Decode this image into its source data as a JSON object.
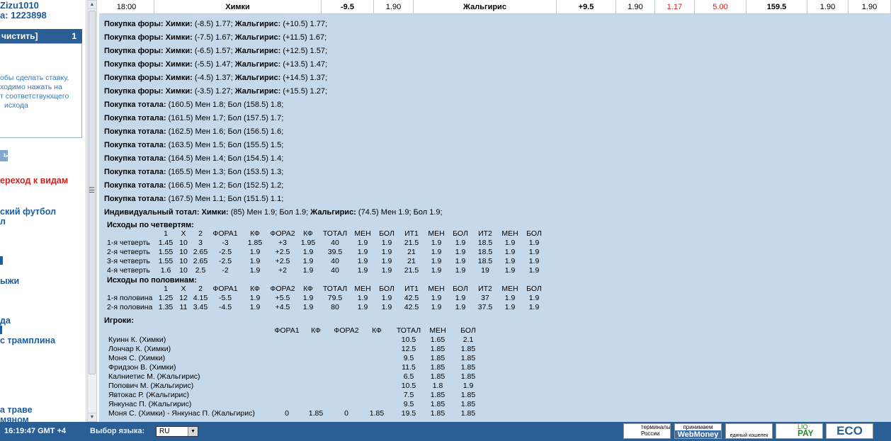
{
  "sidebar": {
    "user_lines": [
      "Zizu1010",
      "а: 1223898"
    ],
    "coupon_title": "чистить]",
    "coupon_count": "1",
    "coupon_hint": [
      "обы сделать ставку,",
      "ходимо нажать на",
      "т соответствующего",
      "исхода"
    ],
    "coupon_button": "ь",
    "nav_red": "ереход к видам",
    "nav_items": [
      "ский футбол",
      "л",
      "",
      "ыжи",
      "да",
      "",
      "с трамплина",
      "а траве",
      "мяном"
    ]
  },
  "event": {
    "time": "18:00",
    "home": "Химки",
    "handicap_home": "-9.5",
    "odd_home": "1.90",
    "away": "Жальгирис",
    "handicap_away": "+9.5",
    "odd_away": "1.90",
    "red1": "1.17",
    "red2": "5.00",
    "total": "159.5",
    "over": "1.90",
    "under": "1.90"
  },
  "lines": [
    [
      "Покупка форы: Химки:",
      " (-8.5) 1.77; ",
      "Жальгирис:",
      " (+10.5) 1.77;"
    ],
    [
      "Покупка форы: Химки:",
      " (-7.5) 1.67; ",
      "Жальгирис:",
      " (+11.5) 1.67;"
    ],
    [
      "Покупка форы: Химки:",
      " (-6.5) 1.57; ",
      "Жальгирис:",
      " (+12.5) 1.57;"
    ],
    [
      "Покупка форы: Химки:",
      " (-5.5) 1.47; ",
      "Жальгирис:",
      " (+13.5) 1.47;"
    ],
    [
      "Покупка форы: Химки:",
      " (-4.5) 1.37; ",
      "Жальгирис:",
      " (+14.5) 1.37;"
    ],
    [
      "Покупка форы: Химки:",
      " (-3.5) 1.27; ",
      "Жальгирис:",
      " (+15.5) 1.27;"
    ],
    [
      "Покупка тотала:",
      " (160.5) Мен 1.8; Бол (158.5) 1.8;",
      "",
      ""
    ],
    [
      "Покупка тотала:",
      " (161.5) Мен 1.7; Бол (157.5) 1.7;",
      "",
      ""
    ],
    [
      "Покупка тотала:",
      " (162.5) Мен 1.6; Бол (156.5) 1.6;",
      "",
      ""
    ],
    [
      "Покупка тотала:",
      " (163.5) Мен 1.5; Бол (155.5) 1.5;",
      "",
      ""
    ],
    [
      "Покупка тотала:",
      " (164.5) Мен 1.4; Бол (154.5) 1.4;",
      "",
      ""
    ],
    [
      "Покупка тотала:",
      " (165.5) Мен 1.3; Бол (153.5) 1.3;",
      "",
      ""
    ],
    [
      "Покупка тотала:",
      " (166.5) Мен 1.2; Бол (152.5) 1.2;",
      "",
      ""
    ],
    [
      "Покупка тотала:",
      " (167.5) Мен 1.1; Бол (151.5) 1.1;",
      "",
      ""
    ],
    [
      "Индивидуальный тотал: Химки:",
      " (85) Мен 1.9; Бол 1.9; ",
      "Жальгирис:",
      " (74.5) Мен 1.9; Бол 1.9;"
    ]
  ],
  "quarters": {
    "title": "Исходы по четвертям:",
    "headers": [
      "",
      "1",
      "X",
      "2",
      "ФОРА1",
      "КФ",
      "ФОРА2",
      "КФ",
      "ТОТАЛ",
      "МЕН",
      "БОЛ",
      "ИТ1",
      "МЕН",
      "БОЛ",
      "ИТ2",
      "МЕН",
      "БОЛ"
    ],
    "rows": [
      [
        "1-я четверть",
        "1.45",
        "10",
        "3",
        "-3",
        "1.85",
        "+3",
        "1.95",
        "40",
        "1.9",
        "1.9",
        "21.5",
        "1.9",
        "1.9",
        "18.5",
        "1.9",
        "1.9"
      ],
      [
        "2-я четверть",
        "1.55",
        "10",
        "2.65",
        "-2.5",
        "1.9",
        "+2.5",
        "1.9",
        "39.5",
        "1.9",
        "1.9",
        "21",
        "1.9",
        "1.9",
        "18.5",
        "1.9",
        "1.9"
      ],
      [
        "3-я четверть",
        "1.55",
        "10",
        "2.65",
        "-2.5",
        "1.9",
        "+2.5",
        "1.9",
        "40",
        "1.9",
        "1.9",
        "21",
        "1.9",
        "1.9",
        "18.5",
        "1.9",
        "1.9"
      ],
      [
        "4-я четверть",
        "1.6",
        "10",
        "2.5",
        "-2",
        "1.9",
        "+2",
        "1.9",
        "40",
        "1.9",
        "1.9",
        "21.5",
        "1.9",
        "1.9",
        "19",
        "1.9",
        "1.9"
      ]
    ]
  },
  "halves": {
    "title": "Исходы по половинам:",
    "headers": [
      "",
      "1",
      "X",
      "2",
      "ФОРА1",
      "КФ",
      "ФОРА2",
      "КФ",
      "ТОТАЛ",
      "МЕН",
      "БОЛ",
      "ИТ1",
      "МЕН",
      "БОЛ",
      "ИТ2",
      "МЕН",
      "БОЛ"
    ],
    "rows": [
      [
        "1-я половина",
        "1.25",
        "12",
        "4.15",
        "-5.5",
        "1.9",
        "+5.5",
        "1.9",
        "79.5",
        "1.9",
        "1.9",
        "42.5",
        "1.9",
        "1.9",
        "37",
        "1.9",
        "1.9"
      ],
      [
        "2-я половина",
        "1.35",
        "11",
        "3.45",
        "-4.5",
        "1.9",
        "+4.5",
        "1.9",
        "80",
        "1.9",
        "1.9",
        "42.5",
        "1.9",
        "1.9",
        "37.5",
        "1.9",
        "1.9"
      ]
    ]
  },
  "players": {
    "title": "Игроки:",
    "headers": [
      "",
      "ФОРА1",
      "КФ",
      "ФОРА2",
      "КФ",
      "ТОТАЛ",
      "МЕН",
      "БОЛ"
    ],
    "rows": [
      [
        "Куинн К. (Химки)",
        "",
        "",
        "",
        "",
        "10.5",
        "1.65",
        "2.1"
      ],
      [
        "Лончар К. (Химки)",
        "",
        "",
        "",
        "",
        "12.5",
        "1.85",
        "1.85"
      ],
      [
        "Моня С. (Химки)",
        "",
        "",
        "",
        "",
        "9.5",
        "1.85",
        "1.85"
      ],
      [
        "Фридзон В. (Химки)",
        "",
        "",
        "",
        "",
        "11.5",
        "1.85",
        "1.85"
      ],
      [
        "Калниетис М. (Жальгирис)",
        "",
        "",
        "",
        "",
        "6.5",
        "1.85",
        "1.85"
      ],
      [
        "Попович М. (Жальгирис)",
        "",
        "",
        "",
        "",
        "10.5",
        "1.8",
        "1.9"
      ],
      [
        "Явтокас Р. (Жальгирис)",
        "",
        "",
        "",
        "",
        "7.5",
        "1.85",
        "1.85"
      ],
      [
        "Янкунас П. (Жальгирис)",
        "",
        "",
        "",
        "",
        "9.5",
        "1.85",
        "1.85"
      ],
      [
        "Моня С. (Химки) - Янкунас П. (Жальгирис)",
        "0",
        "1.85",
        "0",
        "1.85",
        "19.5",
        "1.85",
        "1.85"
      ]
    ]
  },
  "footer": {
    "clock": "16:19:47  GMT +4",
    "lang_label": "Выбор языка:",
    "lang_value": "RU",
    "pay": [
      {
        "name": "terminals",
        "l1": "терминалы",
        "l2": "России"
      },
      {
        "name": "webmoney",
        "l1": "принимаем",
        "l2": "WebMoney"
      },
      {
        "name": "wallet",
        "l1": "единый кошелек",
        "l2": ""
      },
      {
        "name": "liqpay",
        "l1": "LIQ",
        "l2": "PAY"
      },
      {
        "name": "eco",
        "l1": "ECO",
        "l2": ""
      }
    ]
  },
  "colors": {
    "accent": "#2a5f96",
    "panel": "#c5d9ea",
    "red": "#cc2222"
  }
}
